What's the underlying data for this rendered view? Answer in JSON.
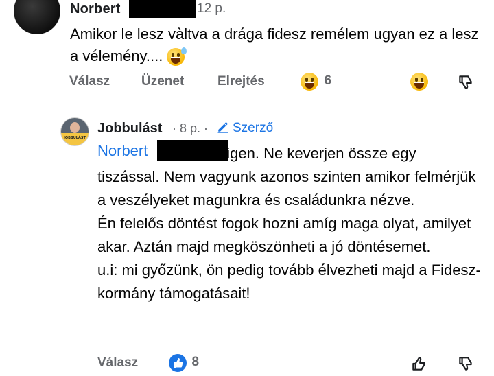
{
  "comment1": {
    "author": "Norbert",
    "time": "12 p.",
    "text": "Amikor le lesz vàltva a drága fidesz remélem ugyan ez a lesz a vélemény....",
    "actions": {
      "reply": "Válasz",
      "message": "Üzenet",
      "hide": "Elrejtés"
    },
    "reaction_count": "6"
  },
  "reply": {
    "author": "Jobbulást",
    "time": "· 8 p. ·",
    "badge": "Szerző",
    "avatar_text": "JOBBULÁST",
    "mention": "Norbert",
    "text": "                   nekem igen. Ne keverjen össze egy tiszással. Nem vagyunk azonos szinten amikor felmérjük a veszélyeket magunkra és családunkra nézve.\nÉn felelős döntést fogok hozni amíg maga olyat, amilyet akar. Aztán majd megköszönheti a jó döntésemet.\nu.i: mi győzünk, ön pedig tovább élvezheti majd a Fidesz-kormány támogatásait!",
    "actions": {
      "reply": "Válasz"
    },
    "like_count": "8"
  },
  "colors": {
    "link": "#1b74e4",
    "muted": "#65676b",
    "redaction": "#000000"
  },
  "icons": [
    "laughing-emoji-icon",
    "sweat-smile-emoji-icon",
    "like-icon",
    "dislike-icon",
    "pencil-icon"
  ]
}
